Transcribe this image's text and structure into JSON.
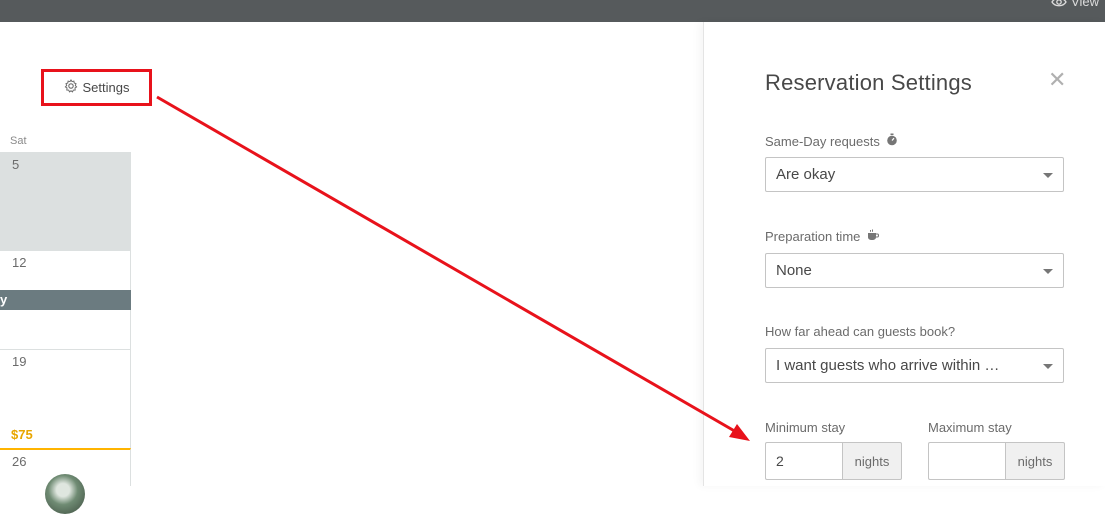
{
  "topbar": {
    "view_label": "View",
    "view_icon": "eye-icon"
  },
  "calendar": {
    "settings_label": "Settings",
    "settings_icon": "gear-icon",
    "day_header": "Sat",
    "cells": [
      {
        "day": "5"
      },
      {
        "day": "12"
      },
      {
        "day": "19",
        "price": "$75"
      },
      {
        "day": "26"
      }
    ],
    "event_label": "y"
  },
  "panel": {
    "title": "Reservation Settings",
    "close_icon": "close-icon",
    "same_day": {
      "label": "Same-Day requests",
      "icon": "stopwatch-icon",
      "value": "Are okay"
    },
    "preparation": {
      "label": "Preparation time",
      "icon": "coffee-cup-icon",
      "value": "None"
    },
    "ahead": {
      "label": "How far ahead can guests book?",
      "value": "I want guests who arrive within …"
    },
    "min_stay": {
      "label": "Minimum stay",
      "value": "2",
      "unit": "nights"
    },
    "max_stay": {
      "label": "Maximum stay",
      "value": "",
      "unit": "nights"
    }
  },
  "colors": {
    "highlight_red": "#e8121b",
    "price_gold": "#e8a600",
    "topbar": "#565a5c"
  }
}
